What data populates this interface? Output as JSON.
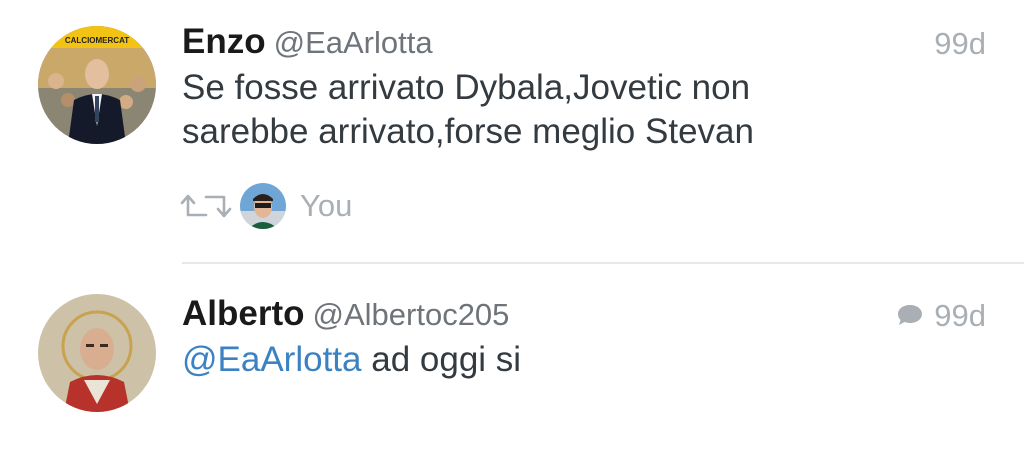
{
  "tweets": [
    {
      "name": "Enzo",
      "handle": "@EaArlotta",
      "time": "99d",
      "text": "Se fosse arrivato Dybala,Jovetic non sarebbe arrivato,forse meglio Stevan",
      "avatar_banner_text": "CALCIOMERCAT"
    },
    {
      "name": "Alberto",
      "handle": "@Albertoc205",
      "time": "99d",
      "mention": "@EaArlotta",
      "text": "ad oggi si"
    }
  ],
  "social_context": {
    "label": "You"
  },
  "icons": {
    "retweet": "retweet-icon",
    "reply": "speech-bubble-icon"
  },
  "colors": {
    "name": "#1a1a1a",
    "handle": "#6e7479",
    "meta": "#a9afb4",
    "mention": "#3b82c4",
    "divider": "#e6e8ea"
  }
}
